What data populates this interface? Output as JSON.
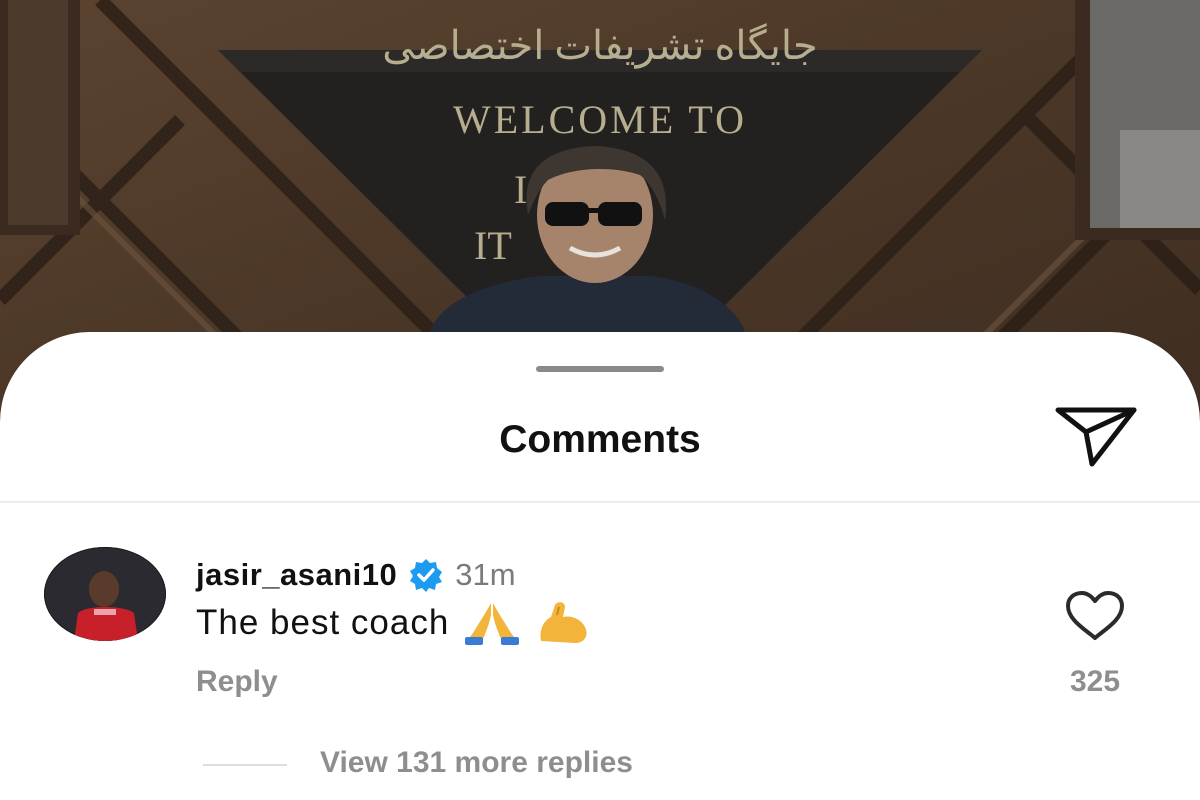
{
  "post": {
    "sign_line_1": "جایگاه تشریفات اختصاصی",
    "sign_line_2": "WELCOME TO",
    "sign_fragment_a": "I",
    "sign_fragment_b": "IT"
  },
  "sheet": {
    "title": "Comments",
    "share_icon": "send-icon"
  },
  "comment": {
    "username": "jasir_asani10",
    "verified_icon": "verified-badge-icon",
    "time": "31m",
    "text": "The best coach",
    "emojis": [
      "folded-hands-emoji",
      "flexed-biceps-emoji"
    ],
    "reply_label": "Reply",
    "like_icon": "heart-icon",
    "like_count": "325",
    "view_replies_label": "View 131 more replies"
  },
  "colors": {
    "verified": "#1d9bf0",
    "muted_text": "#8e8e8e",
    "title_text": "#111111"
  }
}
